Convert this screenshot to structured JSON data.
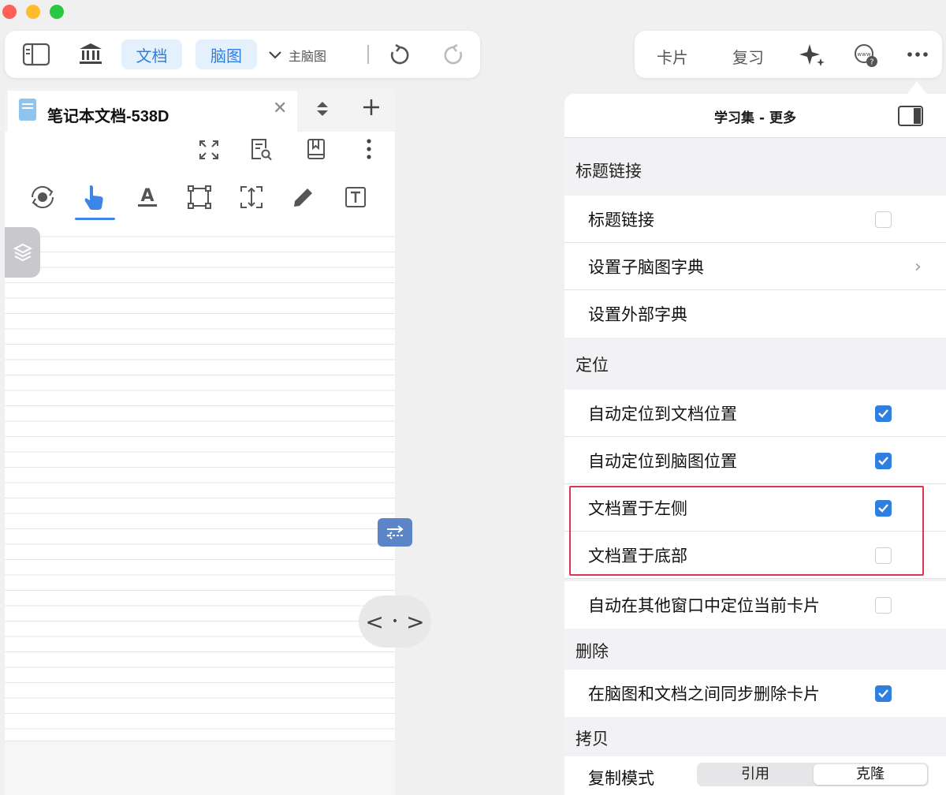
{
  "toolbar": {
    "doc_label": "文档",
    "mindmap_label": "脑图",
    "mindmap_dropdown": "主脑图",
    "cards_label": "卡片",
    "review_label": "复习"
  },
  "document": {
    "tab_title": "笔记本文档-538D"
  },
  "settings": {
    "title": "学习集 - 更多",
    "sections": {
      "heading_link": "标题链接",
      "locate": "定位",
      "delete": "删除",
      "copy": "拷贝"
    },
    "rows": {
      "heading_link": {
        "label": "标题链接",
        "checked": false
      },
      "sub_dict": {
        "label": "设置子脑图字典"
      },
      "ext_dict": {
        "label": "设置外部字典"
      },
      "auto_doc": {
        "label": "自动定位到文档位置",
        "checked": true
      },
      "auto_map": {
        "label": "自动定位到脑图位置",
        "checked": true
      },
      "doc_left": {
        "label": "文档置于左侧",
        "checked": true
      },
      "doc_bottom": {
        "label": "文档置于底部",
        "checked": false
      },
      "auto_other": {
        "label": "自动在其他窗口中定位当前卡片",
        "checked": false
      },
      "sync_delete": {
        "label": "在脑图和文档之间同步删除卡片",
        "checked": true
      },
      "copy_mode": {
        "label": "复制模式",
        "options": [
          "引用",
          "克隆"
        ],
        "selected": "克隆"
      }
    }
  },
  "colors": {
    "accent": "#2f7fe0",
    "highlight": "#e0344f"
  }
}
